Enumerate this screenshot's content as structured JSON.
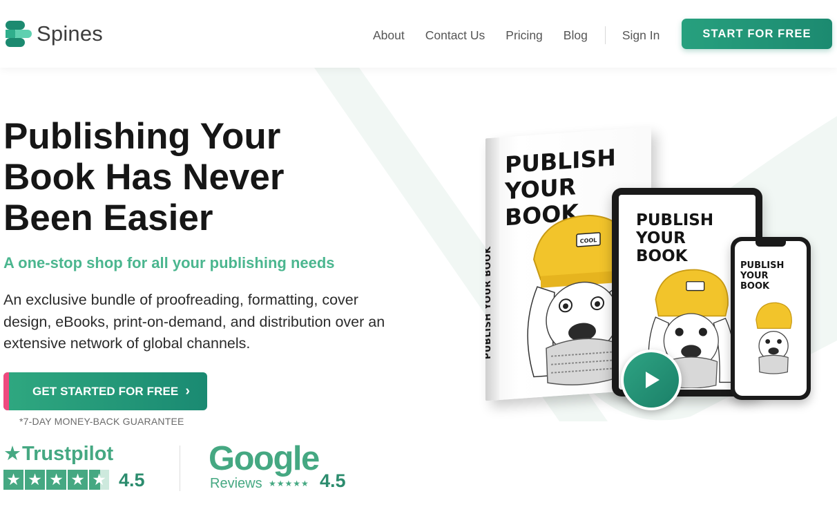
{
  "brand": {
    "name": "Spines",
    "colors": {
      "primary": "#1c8a70",
      "accent_light": "#45a882",
      "cta_accent": "#ef4a7f",
      "subtitle": "#4bb68f"
    }
  },
  "nav": {
    "items": [
      "About",
      "Contact Us",
      "Pricing",
      "Blog"
    ],
    "sign_in": "Sign In",
    "start_button": "START FOR FREE"
  },
  "hero": {
    "title": "Publishing Your Book Has Never Been Easier",
    "subtitle": "A one-stop shop for all your publishing needs",
    "description": "An exclusive bundle of proofreading, formatting, cover design, eBooks, print-on-demand, and distribution over an extensive network of global channels.",
    "cta_label": "GET STARTED FOR FREE",
    "cta_icon": "chevron-right-icon",
    "guarantee": "*7-DAY MONEY-BACK GUARANTEE"
  },
  "mockup": {
    "cover_title": "PUBLISH YOUR BOOK",
    "spine_text": "PUBLISH YOUR BOOK",
    "hat_label": "COOL",
    "play_icon": "play-icon"
  },
  "ratings": {
    "trustpilot": {
      "name": "Trustpilot",
      "score": "4.5",
      "stars_filled": 4.5,
      "stars_total": 5
    },
    "google": {
      "name": "Google",
      "label": "Reviews",
      "stars_glyphs": "★★★★★",
      "score": "4.5"
    }
  }
}
